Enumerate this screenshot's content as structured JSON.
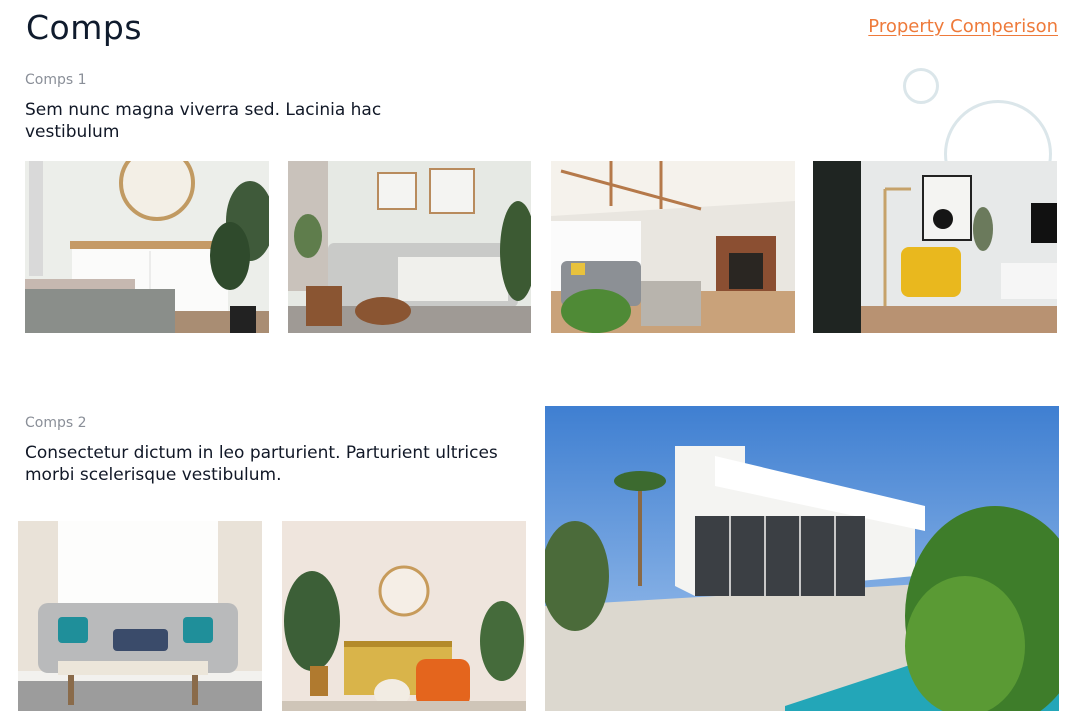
{
  "header": {
    "title": "Comps",
    "compare_link": "Property Comperison"
  },
  "sections": [
    {
      "label": "Comps 1",
      "description": "Sem nunc magna viverra sed. Lacinia hac vestibulum"
    },
    {
      "label": "Comps 2",
      "description": "Consectetur dictum in leo parturient. Parturient ultrices morbi scelerisque vestibulum."
    }
  ],
  "colors": {
    "accent": "#ee7a3a",
    "title": "#0f1b2d",
    "muted": "#8a8f98",
    "decor": "#dbe6ea"
  }
}
